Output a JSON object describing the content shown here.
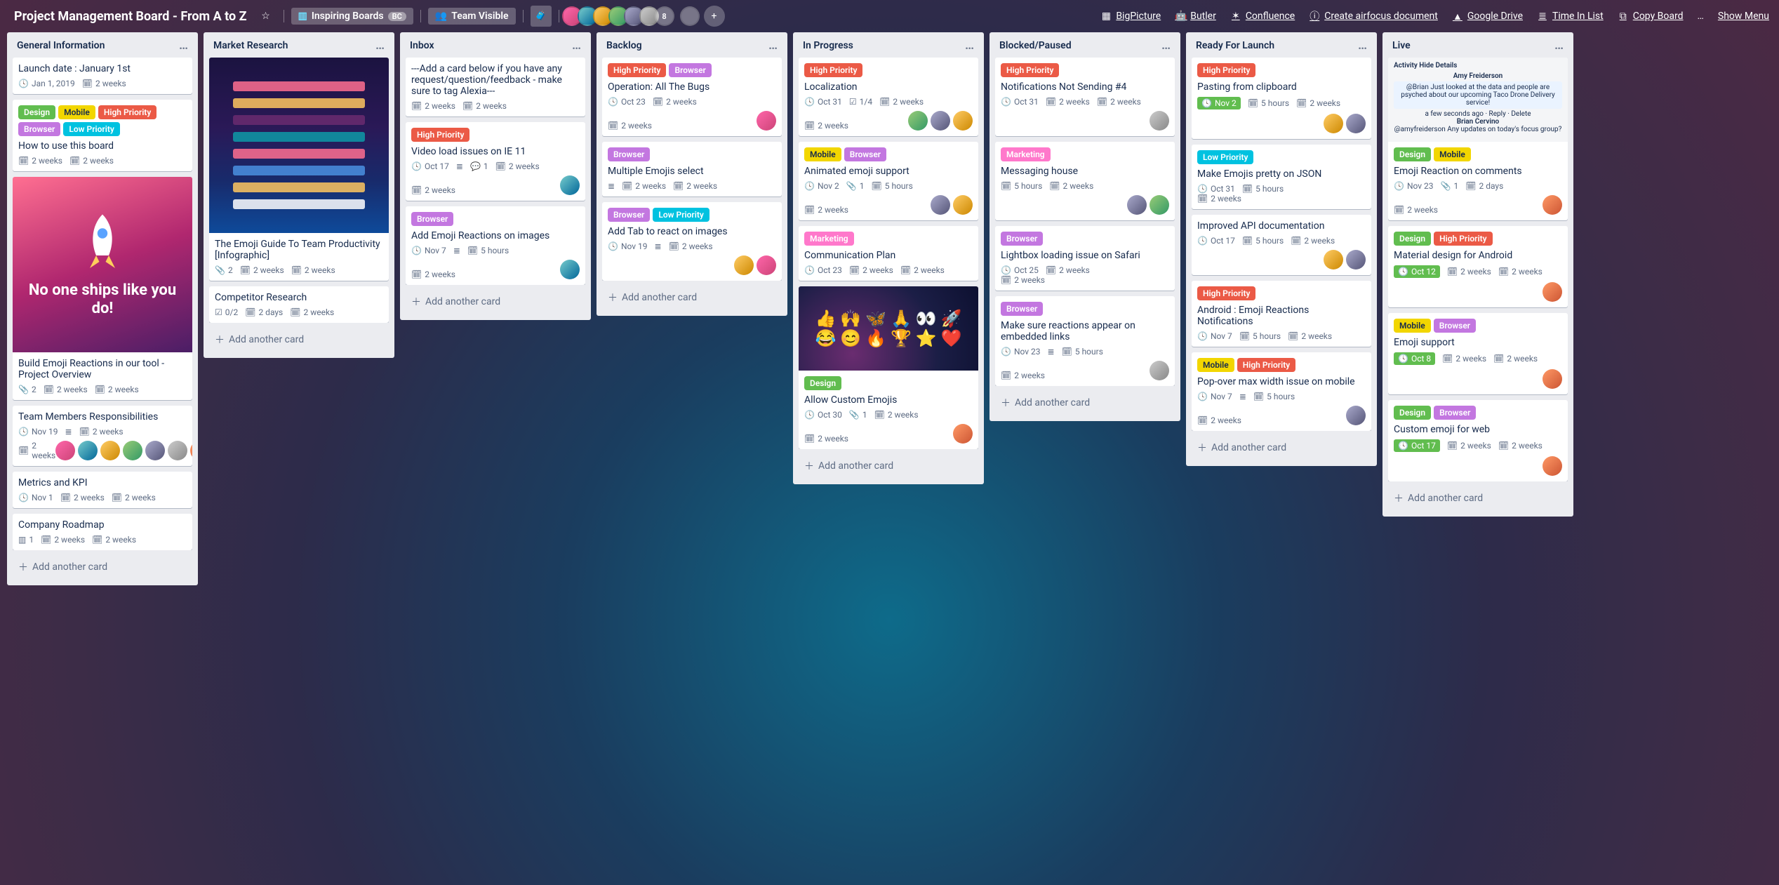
{
  "header": {
    "board_title": "Project Management Board - From A to Z",
    "star_icon": "star-outline-icon",
    "team_chip_icon": "trello-board-icon",
    "team_chip_text": "Inspiring Boards",
    "team_chip_badge": "BC",
    "visibility_icon": "team-icon",
    "visibility_text": "Team Visible",
    "briefcase_icon": "briefcase-icon",
    "member_avatars": [
      "a",
      "b",
      "c",
      "d",
      "e",
      "f"
    ],
    "avatar_more_count": "8",
    "solo_avatar": "user-icon",
    "powerups": [
      {
        "icon": "puzzle-icon",
        "label": "BigPicture"
      },
      {
        "icon": "robot-icon",
        "label": "Butler"
      },
      {
        "icon": "confluence-icon",
        "label": "Confluence"
      },
      {
        "icon": "info-icon",
        "label": "Create airfocus document"
      },
      {
        "icon": "drive-icon",
        "label": "Google Drive"
      },
      {
        "icon": "list-icon",
        "label": "Time In List"
      },
      {
        "icon": "copy-icon",
        "label": "Copy Board"
      }
    ],
    "show_menu": "Show Menu"
  },
  "labels": {
    "Design": "L-green",
    "Mobile": "L-yellow",
    "High Priority": "L-red",
    "Browser": "L-purple",
    "Low Priority": "L-sky",
    "Marketing": "L-pink"
  },
  "lists": [
    {
      "name": "General Information",
      "add_text": "Add another card",
      "cards": [
        {
          "title": "Launch date : January 1st",
          "badges": [
            {
              "t": "due",
              "text": "Jan 1, 2019"
            },
            {
              "t": "time",
              "text": "2 weeks"
            }
          ]
        },
        {
          "labels": [
            "Design",
            "Mobile",
            "High Priority",
            "Browser",
            "Low Priority"
          ],
          "title": "How to use this board",
          "badges": [
            {
              "t": "time",
              "text": "2 weeks"
            },
            {
              "t": "time",
              "text": "2 weeks"
            }
          ]
        },
        {
          "cover": "rocket",
          "cover_caption": "No one ships like you do!",
          "title": "Build Emoji Reactions in our tool - Project Overview",
          "badges": [
            {
              "t": "attach",
              "text": "2"
            },
            {
              "t": "time",
              "text": "2 weeks"
            },
            {
              "t": "time",
              "text": "2 weeks"
            }
          ]
        },
        {
          "title": "Team Members Responsibilities",
          "badges": [
            {
              "t": "due",
              "text": "Nov 19"
            },
            {
              "t": "desc"
            },
            {
              "t": "time",
              "text": "2 weeks"
            }
          ],
          "badges2": [
            {
              "t": "time",
              "text": "2 weeks"
            }
          ],
          "members": [
            "a",
            "b",
            "c",
            "d",
            "e",
            "f",
            "g",
            "h"
          ]
        },
        {
          "title": "Metrics and KPI",
          "badges": [
            {
              "t": "due",
              "text": "Nov 1"
            },
            {
              "t": "time",
              "text": "2 weeks"
            },
            {
              "t": "time",
              "text": "2 weeks"
            }
          ]
        },
        {
          "title": "Company Roadmap",
          "badges": [
            {
              "t": "trello",
              "text": "1"
            },
            {
              "t": "time",
              "text": "2 weeks"
            },
            {
              "t": "time",
              "text": "2 weeks"
            }
          ]
        }
      ]
    },
    {
      "name": "Market Research",
      "add_text": "Add another card",
      "cards": [
        {
          "cover": "infographic",
          "title": "The Emoji Guide To Team Productivity [Infographic]",
          "badges": [
            {
              "t": "attach",
              "text": "2"
            },
            {
              "t": "time",
              "text": "2 weeks"
            },
            {
              "t": "time",
              "text": "2 weeks"
            }
          ]
        },
        {
          "title": "Competitor Research",
          "badges": [
            {
              "t": "check",
              "text": "0/2"
            },
            {
              "t": "time",
              "text": "2 days"
            },
            {
              "t": "time",
              "text": "2 weeks"
            }
          ]
        }
      ]
    },
    {
      "name": "Inbox",
      "add_text": "Add another card",
      "cards": [
        {
          "title": "---Add a card below if you have any request/question/feedback - make sure to tag Alexia---",
          "badges": [
            {
              "t": "time",
              "text": "2 weeks"
            },
            {
              "t": "time",
              "text": "2 weeks"
            }
          ]
        },
        {
          "labels": [
            "High Priority"
          ],
          "title": "Video load issues on IE 11",
          "badges": [
            {
              "t": "due",
              "text": "Oct 17"
            },
            {
              "t": "desc"
            },
            {
              "t": "comment",
              "text": "1"
            },
            {
              "t": "time",
              "text": "2 weeks"
            }
          ],
          "badges2": [
            {
              "t": "time",
              "text": "2 weeks"
            }
          ],
          "members": [
            "b"
          ]
        },
        {
          "labels": [
            "Browser"
          ],
          "title": "Add Emoji Reactions on images",
          "badges": [
            {
              "t": "due",
              "text": "Nov 7"
            },
            {
              "t": "desc"
            },
            {
              "t": "time",
              "text": "5 hours"
            }
          ],
          "badges2": [
            {
              "t": "time",
              "text": "2 weeks"
            }
          ],
          "members": [
            "b"
          ]
        }
      ]
    },
    {
      "name": "Backlog",
      "add_text": "Add another card",
      "cards": [
        {
          "labels": [
            "High Priority",
            "Browser"
          ],
          "title": "Operation: All The Bugs",
          "badges": [
            {
              "t": "due",
              "text": "Oct 23"
            },
            {
              "t": "time",
              "text": "2 weeks"
            }
          ],
          "badges2": [
            {
              "t": "time",
              "text": "2 weeks"
            }
          ],
          "members": [
            "a"
          ]
        },
        {
          "labels": [
            "Browser"
          ],
          "title": "Multiple Emojis select",
          "badges": [
            {
              "t": "desc"
            },
            {
              "t": "time",
              "text": "2 weeks"
            },
            {
              "t": "time",
              "text": "2 weeks"
            }
          ]
        },
        {
          "labels": [
            "Browser",
            "Low Priority"
          ],
          "title": "Add Tab to react on images",
          "badges": [
            {
              "t": "due",
              "text": "Nov 19"
            },
            {
              "t": "desc"
            },
            {
              "t": "time",
              "text": "2 weeks"
            }
          ],
          "members": [
            "c",
            "a"
          ]
        }
      ]
    },
    {
      "name": "In Progress",
      "add_text": "Add another card",
      "cards": [
        {
          "labels": [
            "High Priority"
          ],
          "title": "Localization",
          "badges": [
            {
              "t": "due",
              "text": "Oct 31"
            },
            {
              "t": "check",
              "text": "1/4"
            },
            {
              "t": "time",
              "text": "2 weeks"
            }
          ],
          "badges2": [
            {
              "t": "time",
              "text": "2 weeks"
            }
          ],
          "members": [
            "d",
            "e",
            "c"
          ]
        },
        {
          "labels": [
            "Mobile",
            "Browser"
          ],
          "title": "Animated emoji support",
          "badges": [
            {
              "t": "due",
              "text": "Nov 2"
            },
            {
              "t": "attach",
              "text": "1"
            },
            {
              "t": "time",
              "text": "5 hours"
            }
          ],
          "badges2": [
            {
              "t": "time",
              "text": "2 weeks"
            }
          ],
          "members": [
            "e",
            "c"
          ]
        },
        {
          "labels": [
            "Marketing"
          ],
          "title": "Communication Plan",
          "badges": [
            {
              "t": "due",
              "text": "Oct 23"
            },
            {
              "t": "time",
              "text": "2 weeks"
            },
            {
              "t": "time",
              "text": "2 weeks"
            }
          ]
        },
        {
          "cover": "emoji",
          "labels": [
            "Design"
          ],
          "title": "Allow Custom Emojis",
          "badges": [
            {
              "t": "due",
              "text": "Oct 30"
            },
            {
              "t": "attach",
              "text": "1"
            },
            {
              "t": "time",
              "text": "2 weeks"
            }
          ],
          "badges2": [
            {
              "t": "time",
              "text": "2 weeks"
            }
          ],
          "members": [
            "g"
          ]
        }
      ]
    },
    {
      "name": "Blocked/Paused",
      "add_text": "Add another card",
      "cards": [
        {
          "labels": [
            "High Priority"
          ],
          "title": "Notifications Not Sending #4",
          "badges": [
            {
              "t": "due",
              "text": "Oct 31"
            },
            {
              "t": "time",
              "text": "2 weeks"
            },
            {
              "t": "time",
              "text": "2 weeks"
            }
          ],
          "members": [
            "f"
          ]
        },
        {
          "labels": [
            "Marketing"
          ],
          "title": "Messaging house",
          "badges": [
            {
              "t": "time",
              "text": "5 hours"
            },
            {
              "t": "time",
              "text": "2 weeks"
            }
          ],
          "members": [
            "e",
            "d"
          ]
        },
        {
          "labels": [
            "Browser"
          ],
          "title": "Lightbox loading issue on Safari",
          "badges": [
            {
              "t": "due",
              "text": "Oct 25"
            },
            {
              "t": "time",
              "text": "2 weeks"
            }
          ],
          "badges2": [
            {
              "t": "time",
              "text": "2 weeks"
            }
          ]
        },
        {
          "labels": [
            "Browser"
          ],
          "title": "Make sure reactions appear on embedded links",
          "badges": [
            {
              "t": "due",
              "text": "Nov 23"
            },
            {
              "t": "desc"
            },
            {
              "t": "time",
              "text": "5 hours"
            }
          ],
          "badges2": [
            {
              "t": "time",
              "text": "2 weeks"
            }
          ],
          "members": [
            "f"
          ]
        }
      ]
    },
    {
      "name": "Ready For Launch",
      "add_text": "Add another card",
      "cards": [
        {
          "labels": [
            "High Priority"
          ],
          "title": "Pasting from clipboard",
          "badges": [
            {
              "t": "due-green",
              "text": "Nov 2"
            },
            {
              "t": "time",
              "text": "5 hours"
            },
            {
              "t": "time",
              "text": "2 weeks"
            }
          ],
          "members": [
            "c",
            "e"
          ]
        },
        {
          "labels": [
            "Low Priority"
          ],
          "title": "Make Emojis pretty on JSON",
          "badges": [
            {
              "t": "due",
              "text": "Oct 31"
            },
            {
              "t": "time",
              "text": "5 hours"
            }
          ],
          "badges2": [
            {
              "t": "time",
              "text": "2 weeks"
            }
          ]
        },
        {
          "title": "Improved API documentation",
          "badges": [
            {
              "t": "due",
              "text": "Oct 17"
            },
            {
              "t": "time",
              "text": "5 hours"
            },
            {
              "t": "time",
              "text": "2 weeks"
            }
          ],
          "members": [
            "c",
            "e"
          ]
        },
        {
          "labels": [
            "High Priority"
          ],
          "title": "Android : Emoji Reactions Notifications",
          "badges": [
            {
              "t": "due",
              "text": "Nov 7"
            },
            {
              "t": "time",
              "text": "5 hours"
            },
            {
              "t": "time",
              "text": "2 weeks"
            }
          ]
        },
        {
          "labels": [
            "Mobile",
            "High Priority"
          ],
          "title": "Pop-over max width issue on mobile",
          "badges": [
            {
              "t": "due",
              "text": "Nov 7"
            },
            {
              "t": "desc"
            },
            {
              "t": "time",
              "text": "5 hours"
            }
          ],
          "badges2": [
            {
              "t": "time",
              "text": "2 weeks"
            }
          ],
          "members": [
            "e"
          ]
        }
      ]
    },
    {
      "name": "Live",
      "add_text": "Add another card",
      "cards": [
        {
          "cover": "activity",
          "cover_lines": [
            "Activity                                                       Hide Details",
            "Amy Freiderson",
            "@Brian Just looked at the data and people are psyched about our upcoming Taco Drone Delivery service!",
            "a few seconds ago · Reply · Delete",
            "Brian Cervino",
            "@amyfreiderson Any updates on today's focus group?"
          ],
          "labels": [
            "Design",
            "Mobile"
          ],
          "title": "Emoji Reaction on comments",
          "badges": [
            {
              "t": "due",
              "text": "Nov 23"
            },
            {
              "t": "attach",
              "text": "1"
            },
            {
              "t": "time",
              "text": "2 days"
            }
          ],
          "badges2": [
            {
              "t": "time",
              "text": "2 weeks"
            }
          ],
          "members": [
            "g"
          ]
        },
        {
          "labels": [
            "Design",
            "High Priority"
          ],
          "title": "Material design for Android",
          "badges": [
            {
              "t": "due-green",
              "text": "Oct 12"
            },
            {
              "t": "time",
              "text": "2 weeks"
            },
            {
              "t": "time",
              "text": "2 weeks"
            }
          ],
          "members": [
            "g"
          ]
        },
        {
          "labels": [
            "Mobile",
            "Browser"
          ],
          "title": "Emoji support",
          "badges": [
            {
              "t": "due-green",
              "text": "Oct 8"
            },
            {
              "t": "time",
              "text": "2 weeks"
            },
            {
              "t": "time",
              "text": "2 weeks"
            }
          ],
          "members": [
            "g"
          ]
        },
        {
          "labels": [
            "Design",
            "Browser"
          ],
          "title": "Custom emoji for web",
          "badges": [
            {
              "t": "due-green",
              "text": "Oct 17"
            },
            {
              "t": "time",
              "text": "2 weeks"
            },
            {
              "t": "time",
              "text": "2 weeks"
            }
          ],
          "members": [
            "g"
          ]
        }
      ]
    }
  ]
}
